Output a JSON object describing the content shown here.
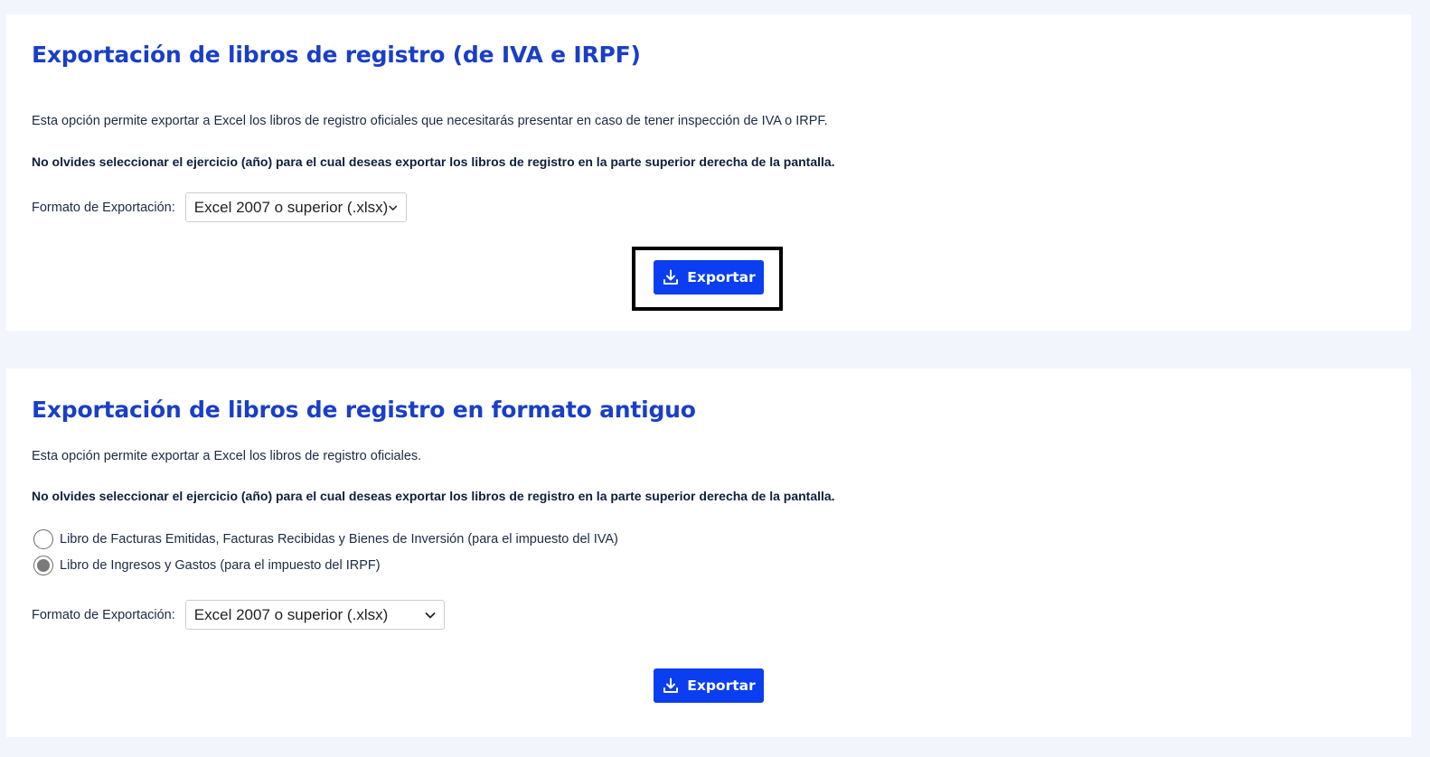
{
  "section1": {
    "title": "Exportación de libros de registro (de IVA e IRPF)",
    "description": "Esta opción permite exportar a Excel los libros de registro oficiales que necesitarás presentar en caso de tener inspección de IVA o IRPF.",
    "note": "No olvides seleccionar el ejercicio (año) para el cual deseas exportar los libros de registro en la parte superior derecha de la pantalla.",
    "format_label": "Formato de Exportación:",
    "format_value": "Excel 2007 o superior (.xlsx)",
    "export_label": "Exportar"
  },
  "section2": {
    "title": "Exportación de libros de registro en formato antiguo",
    "description": "Esta opción permite exportar a Excel los libros de registro oficiales.",
    "note": "No olvides seleccionar el ejercicio (año) para el cual deseas exportar los libros de registro en la parte superior derecha de la pantalla.",
    "options": [
      {
        "label": "Libro de Facturas Emitidas, Facturas Recibidas y Bienes de Inversión (para el impuesto del IVA)",
        "checked": false
      },
      {
        "label": "Libro de Ingresos y Gastos (para el impuesto del IRPF)",
        "checked": true
      }
    ],
    "format_label": "Formato de Exportación:",
    "format_value": "Excel 2007 o superior (.xlsx)",
    "export_label": "Exportar"
  },
  "icons": {
    "download": "download-icon",
    "chevron": "chevron-down-icon"
  },
  "colors": {
    "accent": "#0a3ef0",
    "title": "#1a3fc6",
    "background": "#f2f6fc"
  }
}
